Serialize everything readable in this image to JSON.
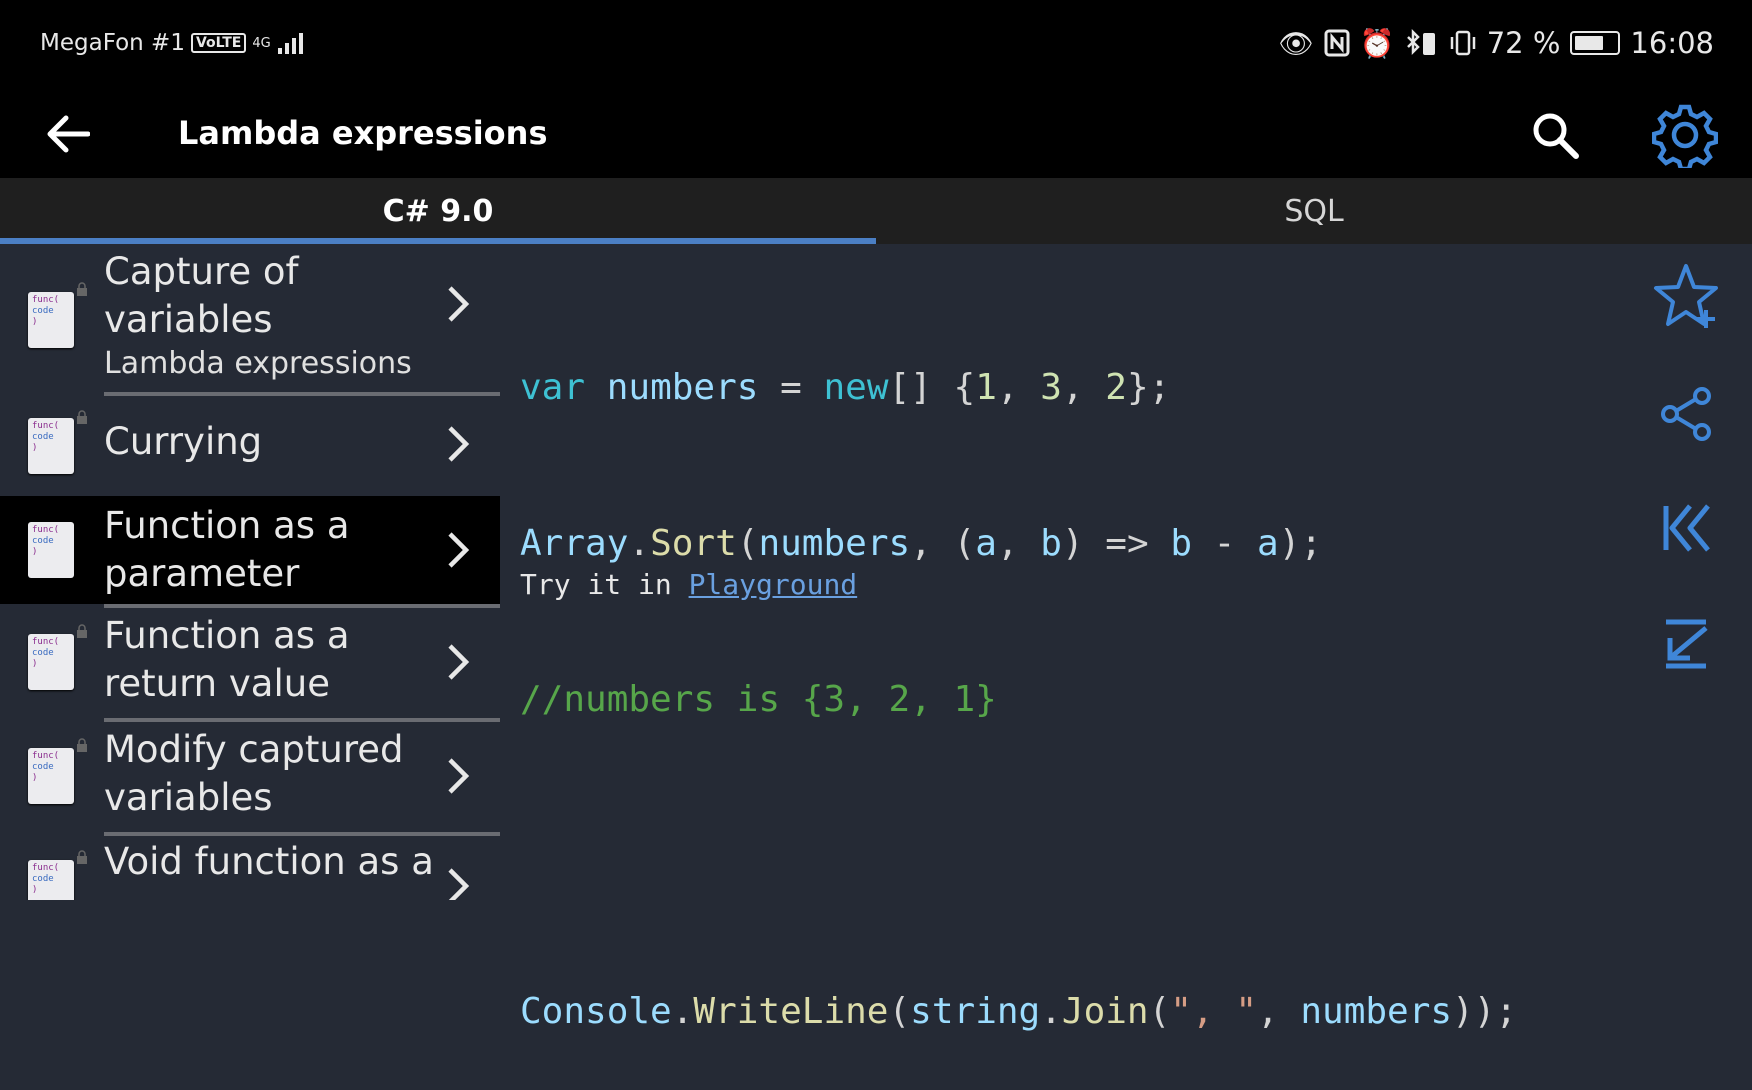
{
  "status_bar": {
    "carrier": "MegaFon #1",
    "volte": "VoLTE",
    "network": "4G",
    "battery": "72 %",
    "battery_level": 0.72,
    "time": "16:08"
  },
  "app_bar": {
    "title": "Lambda expressions"
  },
  "tabs": [
    {
      "label": "C# 9.0",
      "active": true
    },
    {
      "label": "SQL",
      "active": false
    }
  ],
  "topics": [
    {
      "title": "Capture of variables",
      "subtitle": "Lambda expressions",
      "thumb_line1": "func(",
      "thumb_line2": "code",
      "thumb_line3": ")",
      "locked": true,
      "selected": false
    },
    {
      "title": "Currying",
      "subtitle": "",
      "thumb_line1": "func(",
      "thumb_line2": "code",
      "thumb_line3": ")",
      "locked": true,
      "selected": false
    },
    {
      "title": "Function as a parameter",
      "subtitle": "",
      "thumb_line1": "func(",
      "thumb_line2": "code",
      "thumb_line3": ")",
      "locked": false,
      "selected": true
    },
    {
      "title": "Function as a return value",
      "subtitle": "",
      "thumb_line1": "func(",
      "thumb_line2": "code",
      "thumb_line3": ")",
      "locked": true,
      "selected": false
    },
    {
      "title": "Modify captured variables",
      "subtitle": "",
      "thumb_line1": "func(",
      "thumb_line2": "code",
      "thumb_line3": ")",
      "locked": true,
      "selected": false
    },
    {
      "title": "Void function as a",
      "subtitle": "",
      "thumb_line1": "func(",
      "thumb_line2": "code",
      "thumb_line3": ")",
      "locked": true,
      "selected": false
    }
  ],
  "code": {
    "line1": [
      {
        "t": "var",
        "c": "kw"
      },
      {
        "t": " ",
        "c": "plain"
      },
      {
        "t": "numbers",
        "c": "id"
      },
      {
        "t": " = ",
        "c": "plain"
      },
      {
        "t": "new",
        "c": "kw"
      },
      {
        "t": "[] {",
        "c": "plain"
      },
      {
        "t": "1",
        "c": "num"
      },
      {
        "t": ", ",
        "c": "plain"
      },
      {
        "t": "3",
        "c": "num"
      },
      {
        "t": ", ",
        "c": "plain"
      },
      {
        "t": "2",
        "c": "num"
      },
      {
        "t": "};",
        "c": "plain"
      }
    ],
    "line2": [
      {
        "t": "Array",
        "c": "id"
      },
      {
        "t": ".",
        "c": "plain"
      },
      {
        "t": "Sort",
        "c": "fn"
      },
      {
        "t": "(",
        "c": "plain"
      },
      {
        "t": "numbers",
        "c": "id"
      },
      {
        "t": ", (",
        "c": "plain"
      },
      {
        "t": "a",
        "c": "id"
      },
      {
        "t": ", ",
        "c": "plain"
      },
      {
        "t": "b",
        "c": "id"
      },
      {
        "t": ") => ",
        "c": "plain"
      },
      {
        "t": "b",
        "c": "id"
      },
      {
        "t": " - ",
        "c": "plain"
      },
      {
        "t": "a",
        "c": "id"
      },
      {
        "t": ");",
        "c": "plain"
      }
    ],
    "line3": [
      {
        "t": "//numbers is {3, 2, 1}",
        "c": "cmt"
      }
    ],
    "line4": [],
    "line5": [
      {
        "t": "Console",
        "c": "id"
      },
      {
        "t": ".",
        "c": "plain"
      },
      {
        "t": "WriteLine",
        "c": "fn"
      },
      {
        "t": "(",
        "c": "plain"
      },
      {
        "t": "string",
        "c": "id"
      },
      {
        "t": ".",
        "c": "plain"
      },
      {
        "t": "Join",
        "c": "fn"
      },
      {
        "t": "(",
        "c": "plain"
      },
      {
        "t": "\", \"",
        "c": "str"
      },
      {
        "t": ", ",
        "c": "plain"
      },
      {
        "t": "numbers",
        "c": "id"
      },
      {
        "t": "));",
        "c": "plain"
      }
    ]
  },
  "try_it": {
    "prefix": "Try it in ",
    "link": "Playground"
  },
  "rail_icons": [
    "star-add-icon",
    "share-icon",
    "first-page-icon",
    "scroll-to-bottom-icon"
  ],
  "colors": {
    "accent": "#4b7fc4",
    "background": "#252a35",
    "bar": "#000000"
  }
}
